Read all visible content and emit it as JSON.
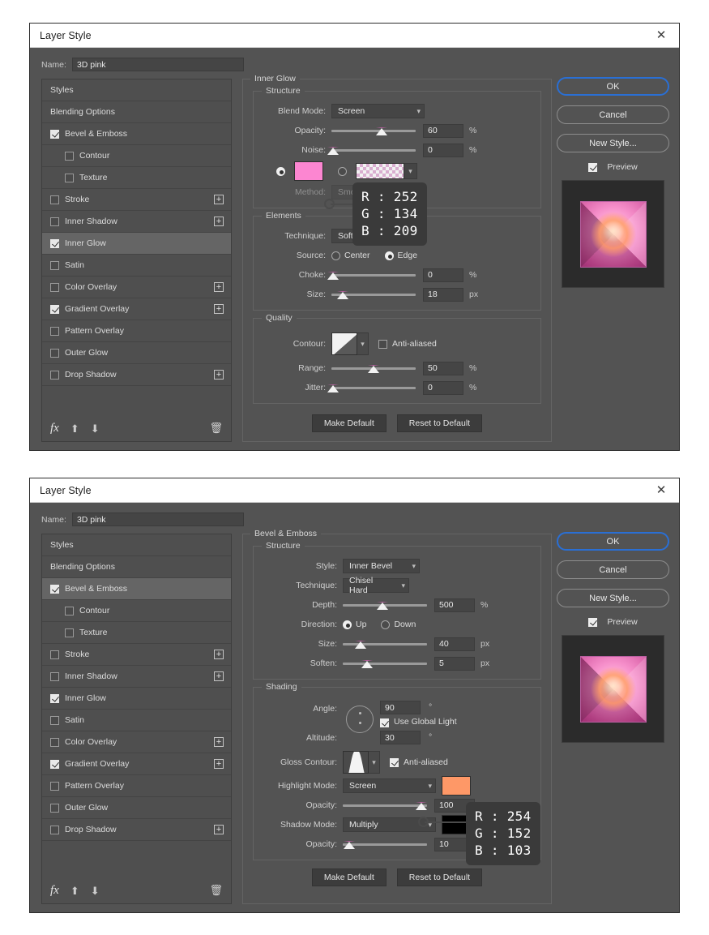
{
  "dialog1": {
    "title": "Layer Style",
    "close_icon": "close-icon",
    "name_label": "Name:",
    "name_value": "3D pink",
    "sidebar": {
      "items": [
        {
          "label": "Styles",
          "type": "plain"
        },
        {
          "label": "Blending Options",
          "type": "plain"
        },
        {
          "label": "Bevel & Emboss",
          "type": "check",
          "checked": true,
          "indent": false,
          "plus": false
        },
        {
          "label": "Contour",
          "type": "check",
          "checked": false,
          "indent": true,
          "plus": false
        },
        {
          "label": "Texture",
          "type": "check",
          "checked": false,
          "indent": true,
          "plus": false
        },
        {
          "label": "Stroke",
          "type": "check",
          "checked": false,
          "indent": false,
          "plus": true
        },
        {
          "label": "Inner Shadow",
          "type": "check",
          "checked": false,
          "indent": false,
          "plus": true
        },
        {
          "label": "Inner Glow",
          "type": "check",
          "checked": true,
          "indent": false,
          "plus": false,
          "selected": true
        },
        {
          "label": "Satin",
          "type": "check",
          "checked": false,
          "indent": false,
          "plus": false
        },
        {
          "label": "Color Overlay",
          "type": "check",
          "checked": false,
          "indent": false,
          "plus": true
        },
        {
          "label": "Gradient Overlay",
          "type": "check",
          "checked": true,
          "indent": false,
          "plus": true
        },
        {
          "label": "Pattern Overlay",
          "type": "check",
          "checked": false,
          "indent": false,
          "plus": false
        },
        {
          "label": "Outer Glow",
          "type": "check",
          "checked": false,
          "indent": false,
          "plus": false
        },
        {
          "label": "Drop Shadow",
          "type": "check",
          "checked": false,
          "indent": false,
          "plus": true
        }
      ],
      "footer": {
        "fx_label": "fx",
        "up_icon": "arrow-up-icon",
        "down_icon": "arrow-down-icon",
        "delete_icon": "trash-icon"
      }
    },
    "panel": {
      "title": "Inner Glow",
      "structure": {
        "title": "Structure",
        "blend_mode_label": "Blend Mode:",
        "blend_mode_value": "Screen",
        "opacity_label": "Opacity:",
        "opacity_value": "60",
        "opacity_unit": "%",
        "opacity_pct": 60,
        "noise_label": "Noise:",
        "noise_value": "0",
        "noise_unit": "%",
        "noise_pct": 0,
        "color_swatch": "#fc86d1",
        "gradient_swatch": "pink-transparent-checker",
        "method_label": "Method:",
        "method_value": "Smoother"
      },
      "elements": {
        "title": "Elements",
        "technique_label": "Technique:",
        "technique_value": "Softer",
        "source_label": "Source:",
        "source_center": "Center",
        "source_edge": "Edge",
        "source_selected": "Edge",
        "choke_label": "Choke:",
        "choke_value": "0",
        "choke_unit": "%",
        "choke_pct": 0,
        "size_label": "Size:",
        "size_value": "18",
        "size_unit": "px",
        "size_pct": 12
      },
      "quality": {
        "title": "Quality",
        "contour_label": "Contour:",
        "antialiased_label": "Anti-aliased",
        "antialiased_checked": false,
        "range_label": "Range:",
        "range_value": "50",
        "range_unit": "%",
        "range_pct": 50,
        "jitter_label": "Jitter:",
        "jitter_value": "0",
        "jitter_unit": "%",
        "jitter_pct": 0
      },
      "make_default": "Make Default",
      "reset_default": "Reset to Default"
    },
    "buttons": {
      "ok": "OK",
      "cancel": "Cancel",
      "new_style": "New Style...",
      "preview_label": "Preview",
      "preview_checked": true
    },
    "tooltip": {
      "r": "R : 252",
      "g": "G : 134",
      "b": "B : 209",
      "color": "#fc86d1"
    }
  },
  "dialog2": {
    "title": "Layer Style",
    "close_icon": "close-icon",
    "name_label": "Name:",
    "name_value": "3D pink",
    "sidebar": {
      "items": [
        {
          "label": "Styles",
          "type": "plain"
        },
        {
          "label": "Blending Options",
          "type": "plain"
        },
        {
          "label": "Bevel & Emboss",
          "type": "check",
          "checked": true,
          "indent": false,
          "plus": false,
          "selected": true
        },
        {
          "label": "Contour",
          "type": "check",
          "checked": false,
          "indent": true,
          "plus": false
        },
        {
          "label": "Texture",
          "type": "check",
          "checked": false,
          "indent": true,
          "plus": false
        },
        {
          "label": "Stroke",
          "type": "check",
          "checked": false,
          "indent": false,
          "plus": true
        },
        {
          "label": "Inner Shadow",
          "type": "check",
          "checked": false,
          "indent": false,
          "plus": true
        },
        {
          "label": "Inner Glow",
          "type": "check",
          "checked": true,
          "indent": false,
          "plus": false
        },
        {
          "label": "Satin",
          "type": "check",
          "checked": false,
          "indent": false,
          "plus": false
        },
        {
          "label": "Color Overlay",
          "type": "check",
          "checked": false,
          "indent": false,
          "plus": true
        },
        {
          "label": "Gradient Overlay",
          "type": "check",
          "checked": true,
          "indent": false,
          "plus": true
        },
        {
          "label": "Pattern Overlay",
          "type": "check",
          "checked": false,
          "indent": false,
          "plus": false
        },
        {
          "label": "Outer Glow",
          "type": "check",
          "checked": false,
          "indent": false,
          "plus": false
        },
        {
          "label": "Drop Shadow",
          "type": "check",
          "checked": false,
          "indent": false,
          "plus": true
        }
      ],
      "footer": {
        "fx_label": "fx",
        "up_icon": "arrow-up-icon",
        "down_icon": "arrow-down-icon",
        "delete_icon": "trash-icon"
      }
    },
    "panel": {
      "title": "Bevel & Emboss",
      "structure": {
        "title": "Structure",
        "style_label": "Style:",
        "style_value": "Inner Bevel",
        "technique_label": "Technique:",
        "technique_value": "Chisel Hard",
        "depth_label": "Depth:",
        "depth_value": "500",
        "depth_unit": "%",
        "depth_pct": 47,
        "direction_label": "Direction:",
        "direction_up": "Up",
        "direction_down": "Down",
        "direction_selected": "Up",
        "size_label": "Size:",
        "size_value": "40",
        "size_unit": "px",
        "size_pct": 21,
        "soften_label": "Soften:",
        "soften_value": "5",
        "soften_unit": "px",
        "soften_pct": 29
      },
      "shading": {
        "title": "Shading",
        "angle_label": "Angle:",
        "angle_value": "90",
        "angle_unit": "°",
        "use_global_light_label": "Use Global Light",
        "use_global_light_checked": true,
        "altitude_label": "Altitude:",
        "altitude_value": "30",
        "altitude_unit": "°",
        "gloss_contour_label": "Gloss Contour:",
        "antialiased_label": "Anti-aliased",
        "antialiased_checked": true,
        "highlight_mode_label": "Highlight Mode:",
        "highlight_mode_value": "Screen",
        "highlight_color": "#fe9867",
        "highlight_opacity_label": "Opacity:",
        "highlight_opacity_value": "100",
        "highlight_opacity_unit": "%",
        "highlight_opacity_pct": 92,
        "shadow_mode_label": "Shadow Mode:",
        "shadow_mode_value": "Multiply",
        "shadow_color": "#000000",
        "shadow_opacity_label": "Opacity:",
        "shadow_opacity_value": "10",
        "shadow_opacity_unit": "%",
        "shadow_opacity_pct": 8
      },
      "make_default": "Make Default",
      "reset_default": "Reset to Default"
    },
    "buttons": {
      "ok": "OK",
      "cancel": "Cancel",
      "new_style": "New Style...",
      "preview_label": "Preview",
      "preview_checked": true
    },
    "tooltip": {
      "r": "R : 254",
      "g": "G : 152",
      "b": "B : 103",
      "color": "#fe9867"
    }
  }
}
